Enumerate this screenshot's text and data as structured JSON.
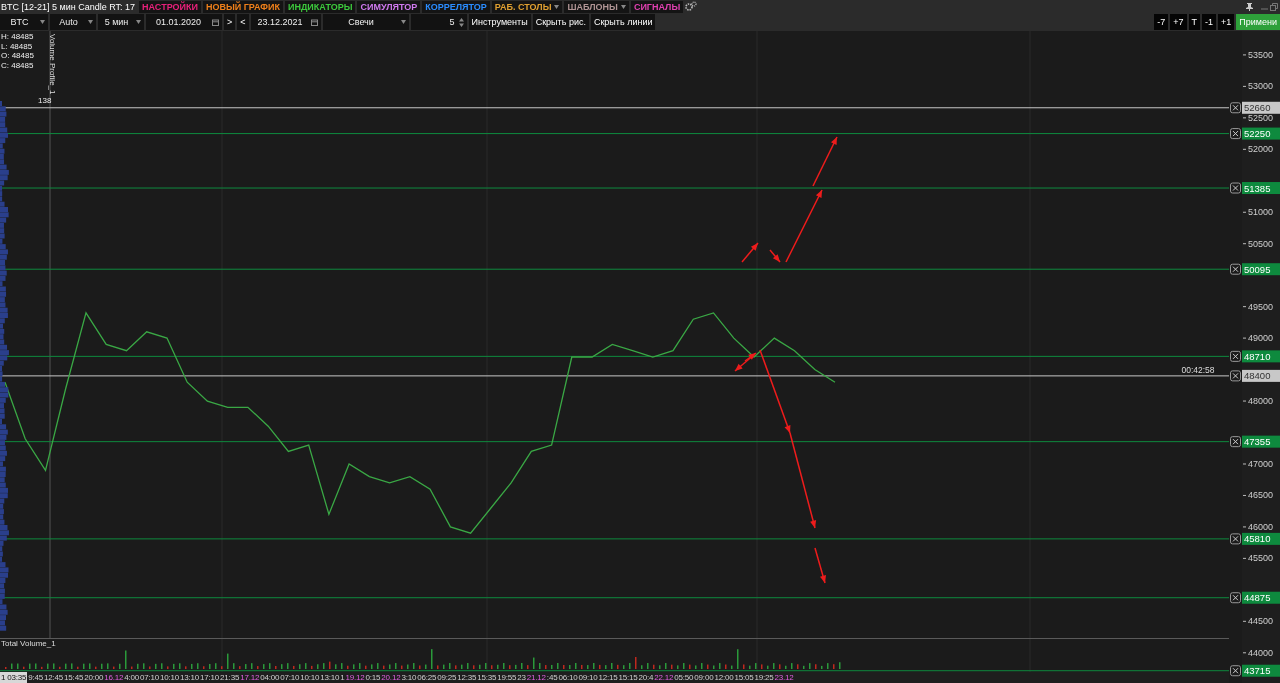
{
  "title": "BTC [12-21] 5 мин Candle RT: 17",
  "menu": [
    {
      "label": "НАСТРОЙКИ",
      "color": "#e8207a",
      "dropdown": false
    },
    {
      "label": "НОВЫЙ ГРАФИК",
      "color": "#f0801a",
      "dropdown": false
    },
    {
      "label": "ИНДИКАТОРЫ",
      "color": "#3cc83c",
      "dropdown": false
    },
    {
      "label": "СИМУЛЯТОР",
      "color": "#d07af0",
      "dropdown": false
    },
    {
      "label": "КОРРЕЛЯТОР",
      "color": "#2a8cff",
      "dropdown": false
    },
    {
      "label": "РАБ. СТОЛЫ",
      "color": "#e0a030",
      "dropdown": true
    },
    {
      "label": "ШАБЛОНЫ",
      "color": "#b09494",
      "dropdown": true
    },
    {
      "label": "СИГНАЛЫ",
      "color": "#e040b0",
      "dropdown": false
    }
  ],
  "toolbar": [
    {
      "kind": "select",
      "value": "BTC"
    },
    {
      "kind": "select",
      "value": "Auto"
    },
    {
      "kind": "select",
      "value": "5 мин"
    },
    {
      "kind": "date",
      "value": "01.01.2020"
    },
    {
      "kind": "button",
      "value": ">"
    },
    {
      "kind": "button",
      "value": "<"
    },
    {
      "kind": "date",
      "value": "23.12.2021"
    },
    {
      "kind": "select",
      "value": "Свечи"
    },
    {
      "kind": "spinner",
      "value": "5"
    },
    {
      "kind": "button",
      "value": "Инструменты"
    },
    {
      "kind": "button",
      "value": "Скрыть рис."
    },
    {
      "kind": "button",
      "value": "Скрыть линии"
    }
  ],
  "shift_buttons": [
    "-7",
    "+7",
    "T",
    "-1",
    "+1"
  ],
  "apply_button": "Примени",
  "ohlc": [
    "H: 48485",
    "L: 48485",
    "O: 48485",
    "C: 48485"
  ],
  "volume_profile": {
    "label": "Volume Profile_1",
    "value": "138"
  },
  "chart_data": {
    "type": "line",
    "ylim": [
      43520,
      53880
    ],
    "yticks": [
      53500,
      53000,
      52500,
      52000,
      51000,
      50500,
      49500,
      49000,
      48000,
      47000,
      46500,
      46000,
      45500,
      44500,
      44000
    ],
    "ref_lines": [
      {
        "axis": "y",
        "value": 52660,
        "label": "52660",
        "color": "#c8c8c8"
      },
      {
        "axis": "y",
        "value": 52250,
        "label": "52250",
        "color": "#0e8a3e"
      },
      {
        "axis": "y",
        "value": 51385,
        "label": "51385",
        "color": "#0e8a3e"
      },
      {
        "axis": "y",
        "value": 50095,
        "label": "50095",
        "color": "#0e8a3e"
      },
      {
        "axis": "y",
        "value": 48710,
        "label": "48710",
        "color": "#0e8a3e"
      },
      {
        "axis": "y",
        "value": 48400,
        "label": "48400",
        "color": "#c8c8c8"
      },
      {
        "axis": "y",
        "value": 47355,
        "label": "47355",
        "color": "#0e8a3e"
      },
      {
        "axis": "y",
        "value": 45810,
        "label": "45810",
        "color": "#0e8a3e"
      },
      {
        "axis": "y",
        "value": 44875,
        "label": "44875",
        "color": "#0e8a3e"
      },
      {
        "axis": "y",
        "value": 43715,
        "label": "43715",
        "color": "#0e8a3e"
      }
    ],
    "series": [
      {
        "color": "#3aa845",
        "values": [
          48300,
          47400,
          46900,
          48200,
          49400,
          48900,
          48800,
          49100,
          49000,
          48300,
          48000,
          47900,
          47900,
          47600,
          47200,
          47300,
          46200,
          47000,
          46800,
          46700,
          46800,
          46600,
          46000,
          45900,
          46300,
          46700,
          47200,
          47300,
          48700,
          48700,
          48900,
          48800,
          48700,
          48800,
          49300,
          49400,
          49000,
          48700,
          49000,
          48800,
          48500,
          48300
        ]
      }
    ]
  },
  "timer": "00:42:58",
  "volume_pane": {
    "label": "Total Volume_1"
  },
  "time_axis": [
    {
      "label": "1 03:35",
      "kind": "cursor"
    },
    {
      "label": "9:45",
      "kind": "time"
    },
    {
      "label": "12:45",
      "kind": "time"
    },
    {
      "label": "15:45",
      "kind": "time"
    },
    {
      "label": "20:00",
      "kind": "time"
    },
    {
      "label": "16.12",
      "kind": "date"
    },
    {
      "label": "4:00",
      "kind": "time"
    },
    {
      "label": "07:10",
      "kind": "time"
    },
    {
      "label": "10:10",
      "kind": "time"
    },
    {
      "label": "13:10",
      "kind": "time"
    },
    {
      "label": "17:10",
      "kind": "time"
    },
    {
      "label": "21:35",
      "kind": "time"
    },
    {
      "label": "17.12",
      "kind": "date"
    },
    {
      "label": "04:00",
      "kind": "time"
    },
    {
      "label": "07:10",
      "kind": "time"
    },
    {
      "label": "10:10",
      "kind": "time"
    },
    {
      "label": "13:10",
      "kind": "time"
    },
    {
      "label": "1",
      "kind": "time"
    },
    {
      "label": "19.12",
      "kind": "date"
    },
    {
      "label": "0:15",
      "kind": "time"
    },
    {
      "label": "20.12",
      "kind": "date"
    },
    {
      "label": "3:10",
      "kind": "time"
    },
    {
      "label": "06:25",
      "kind": "time"
    },
    {
      "label": "09:25",
      "kind": "time"
    },
    {
      "label": "12:35",
      "kind": "time"
    },
    {
      "label": "15:35",
      "kind": "time"
    },
    {
      "label": "19:55",
      "kind": "time"
    },
    {
      "label": "23",
      "kind": "time"
    },
    {
      "label": "21.12",
      "kind": "date"
    },
    {
      "label": ":45",
      "kind": "time"
    },
    {
      "label": "06:10",
      "kind": "time"
    },
    {
      "label": "09:10",
      "kind": "time"
    },
    {
      "label": "12:15",
      "kind": "time"
    },
    {
      "label": "15:15",
      "kind": "time"
    },
    {
      "label": "20:4",
      "kind": "time"
    },
    {
      "label": "22.12",
      "kind": "date"
    },
    {
      "label": "05:50",
      "kind": "time"
    },
    {
      "label": "09:00",
      "kind": "time"
    },
    {
      "label": "12:00",
      "kind": "time"
    },
    {
      "label": "15:05",
      "kind": "time"
    },
    {
      "label": "19:25",
      "kind": "time"
    },
    {
      "label": "23.12",
      "kind": "date"
    }
  ]
}
